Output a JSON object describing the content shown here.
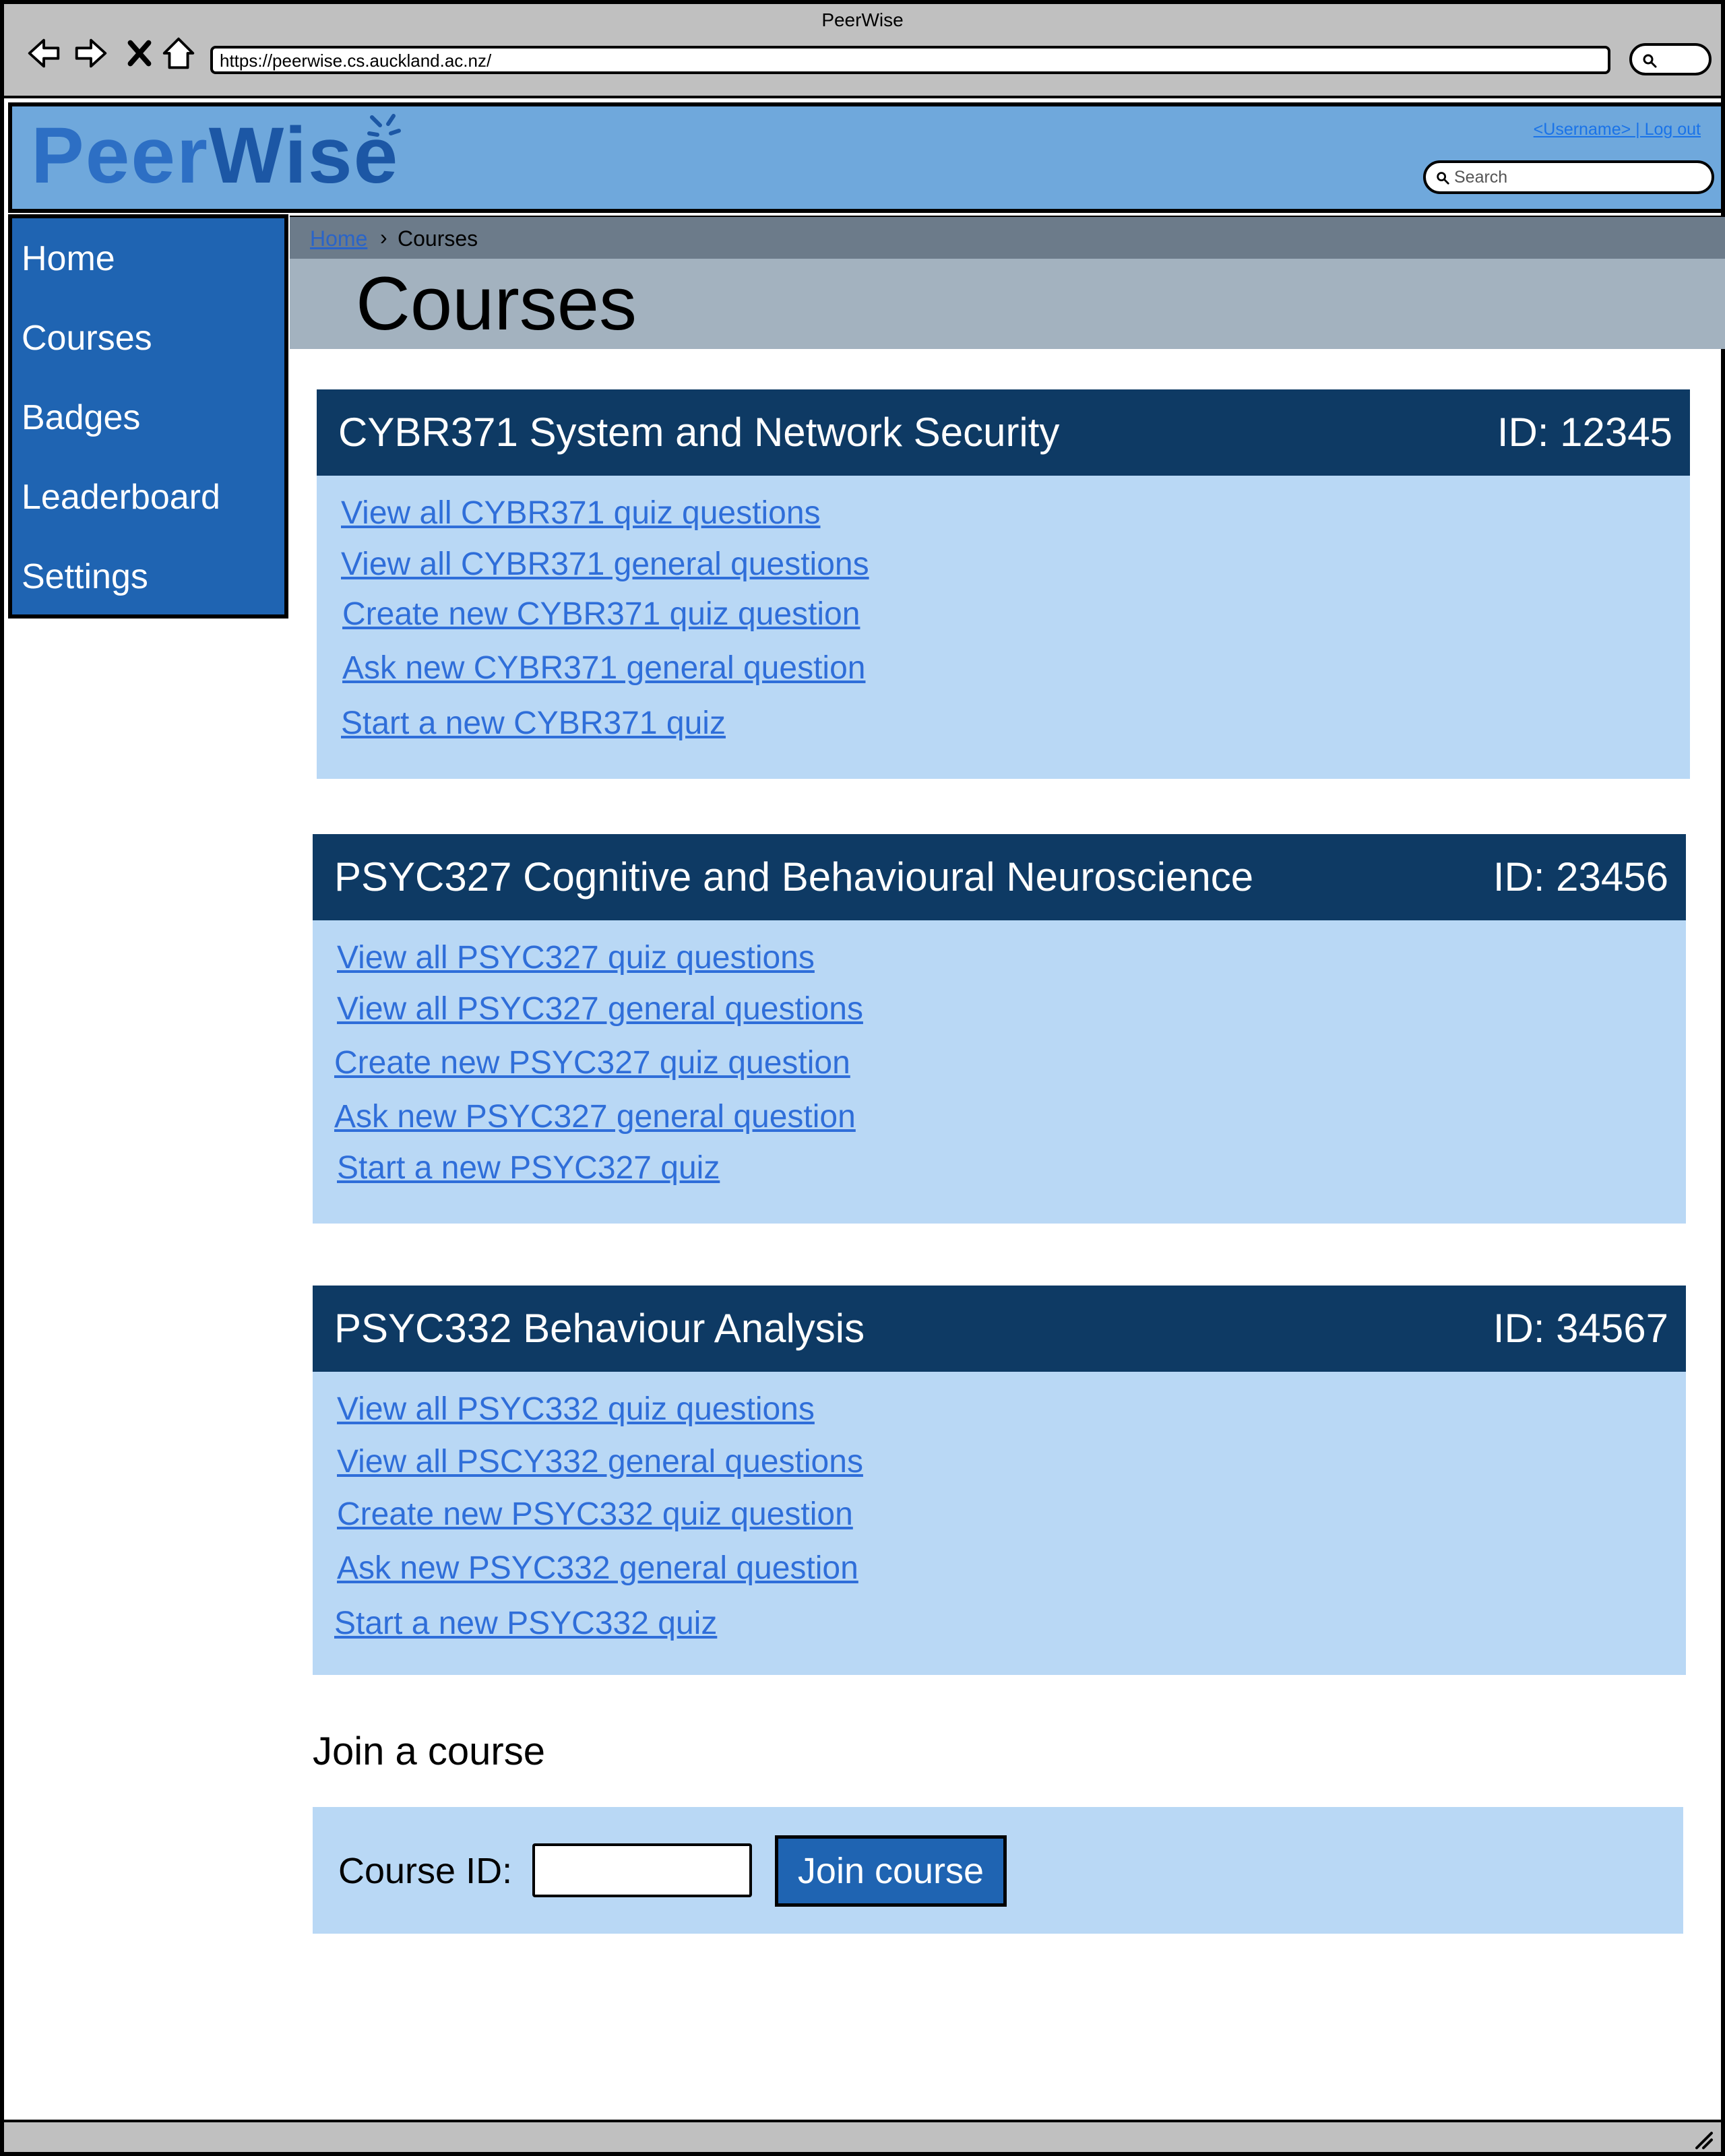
{
  "browser": {
    "window_title": "PeerWise",
    "url": "https://peerwise.cs.auckland.ac.nz/"
  },
  "header": {
    "logo_peer": "Peer",
    "logo_wise": "Wise",
    "user_links": "<Username> | Log out",
    "search_placeholder": "Search"
  },
  "sidebar": {
    "items": [
      {
        "label": "Home"
      },
      {
        "label": "Courses"
      },
      {
        "label": "Badges"
      },
      {
        "label": "Leaderboard"
      },
      {
        "label": "Settings"
      }
    ]
  },
  "breadcrumb": {
    "home": "Home",
    "separator": "›",
    "current": "Courses"
  },
  "page_title": "Courses",
  "courses": [
    {
      "name": "CYBR371 System and Network Security",
      "id": "ID: 12345",
      "links": [
        "View all CYBR371 quiz questions",
        "View all CYBR371 general questions",
        "Create new CYBR371 quiz question",
        "Ask new CYBR371 general question",
        "Start a new CYBR371 quiz"
      ]
    },
    {
      "name": "PSYC327 Cognitive and Behavioural Neuroscience",
      "id": "ID: 23456",
      "links": [
        "View all PSYC327 quiz questions",
        "View all PSYC327 general questions",
        "Create new PSYC327 quiz question",
        "Ask new PSYC327 general question",
        "Start a new PSYC327 quiz"
      ]
    },
    {
      "name": "PSYC332 Behaviour Analysis",
      "id": "ID: 34567",
      "links": [
        "View all PSYC332 quiz questions",
        "View all PSCY332 general questions",
        "Create new PSYC332 quiz question",
        "Ask new PSYC332 general question",
        "Start a new PSYC332 quiz"
      ]
    }
  ],
  "join": {
    "title": "Join a course",
    "label": "Course ID:",
    "input_value": "",
    "button_label": "Join course"
  },
  "colors": {
    "header_bg": "#6fa8dc",
    "sidebar_bg": "#1f64b2",
    "card_head_bg": "#0e3a64",
    "card_body_bg": "#b9d8f5",
    "link": "#2f6ed9"
  }
}
